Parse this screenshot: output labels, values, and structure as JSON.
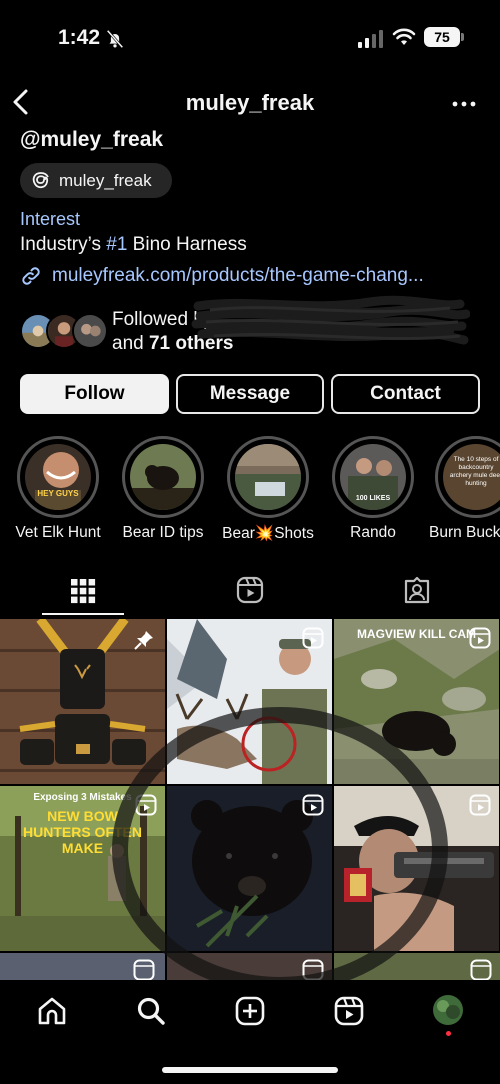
{
  "status": {
    "time": "1:42",
    "battery": "75"
  },
  "header": {
    "username": "muley_freak"
  },
  "profile": {
    "handle": "@muley_freak",
    "threads_label": "muley_freak",
    "category": "Interest",
    "bio_prefix": "Industry’s ",
    "bio_highlight": "#1",
    "bio_suffix": " Bino Harness",
    "link": "muleyfreak.com/products/the-game-chang...",
    "followed_by_line1": "Followed by",
    "followed_by_and": "and ",
    "followed_by_count": "71 others"
  },
  "actions": {
    "follow": "Follow",
    "message": "Message",
    "contact": "Contact"
  },
  "highlights": [
    {
      "label": "Vet Elk Hunt",
      "caption": "HEY GUYS"
    },
    {
      "label": "Bear ID tips",
      "caption": ""
    },
    {
      "label": "Bear💥Shots",
      "caption": ""
    },
    {
      "label": "Rando",
      "caption": "100 LIKES"
    },
    {
      "label": "Burn Buck",
      "caption": "The 10 steps of backcountry archery mule deer hunting"
    }
  ],
  "posts": [
    {
      "overlay": ""
    },
    {
      "overlay": ""
    },
    {
      "overlay": "MAGVIEW KILL CAM"
    },
    {
      "overlay_top": "Exposing 3 Mistakes",
      "overlay": "NEW BOW HUNTERS OFTEN MAKE"
    },
    {
      "overlay": ""
    },
    {
      "overlay": ""
    }
  ],
  "colors": {
    "link": "#a7c7ff",
    "background": "#000000",
    "pill": "#262626",
    "notification_dot": "#ff3040"
  }
}
